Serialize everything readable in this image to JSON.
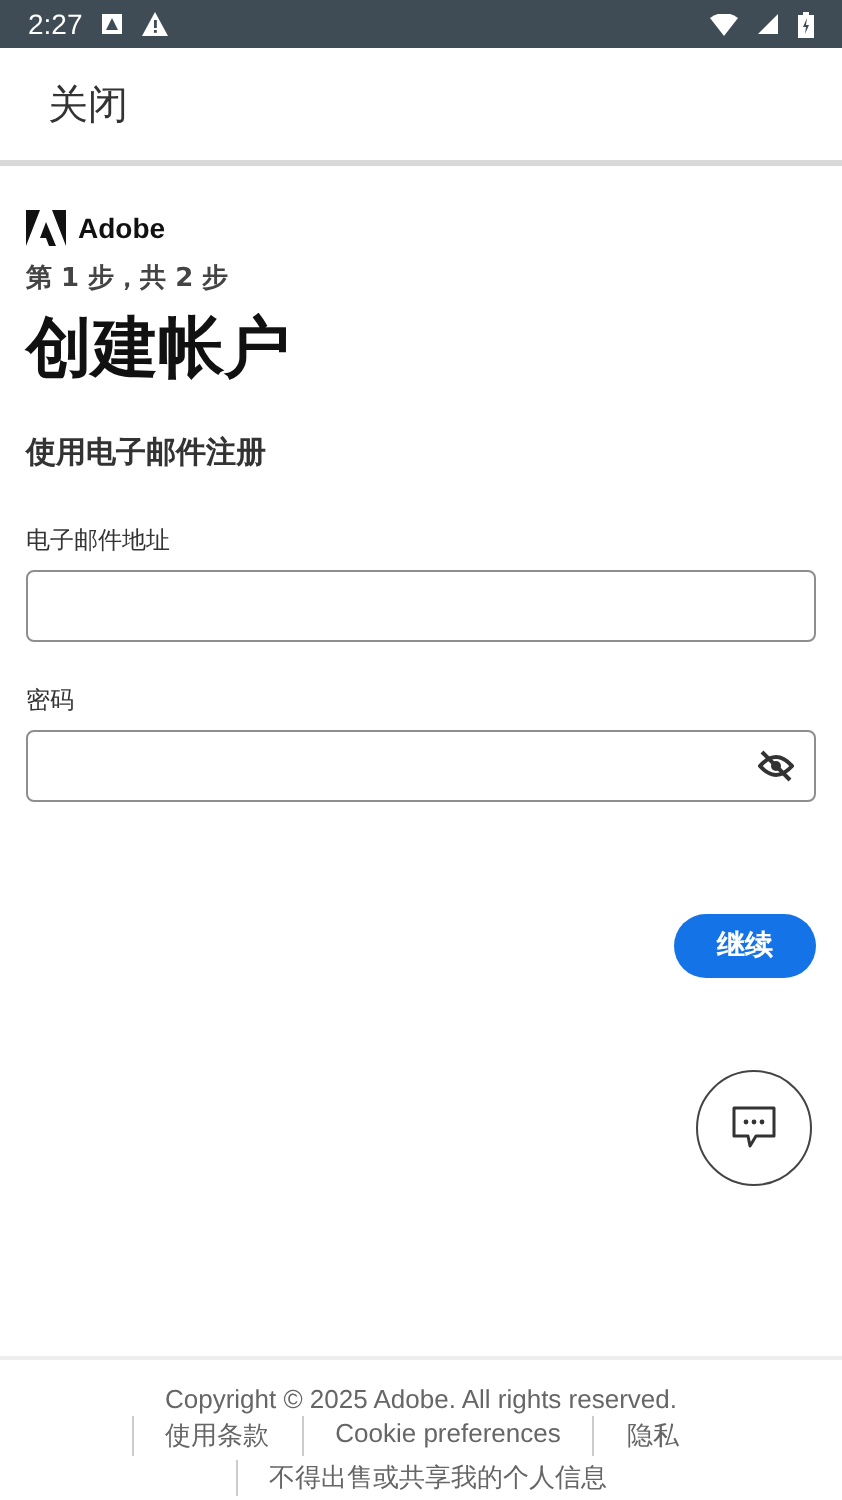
{
  "status_bar": {
    "time": "2:27"
  },
  "app_bar": {
    "close": "关闭"
  },
  "brand": "Adobe",
  "step": "第 1 步，共 2 步",
  "title": "创建帐户",
  "subtitle": "使用电子邮件注册",
  "fields": [
    {
      "label": "电子邮件地址",
      "kind": "text"
    },
    {
      "label": "密码",
      "kind": "password"
    }
  ],
  "continue": "继续",
  "footer": {
    "copyright": "Copyright © 2025 Adobe. All rights reserved.",
    "links": [
      "使用条款",
      "Cookie preferences",
      "隐私"
    ],
    "more": "不得出售或共享我的个人信息"
  }
}
